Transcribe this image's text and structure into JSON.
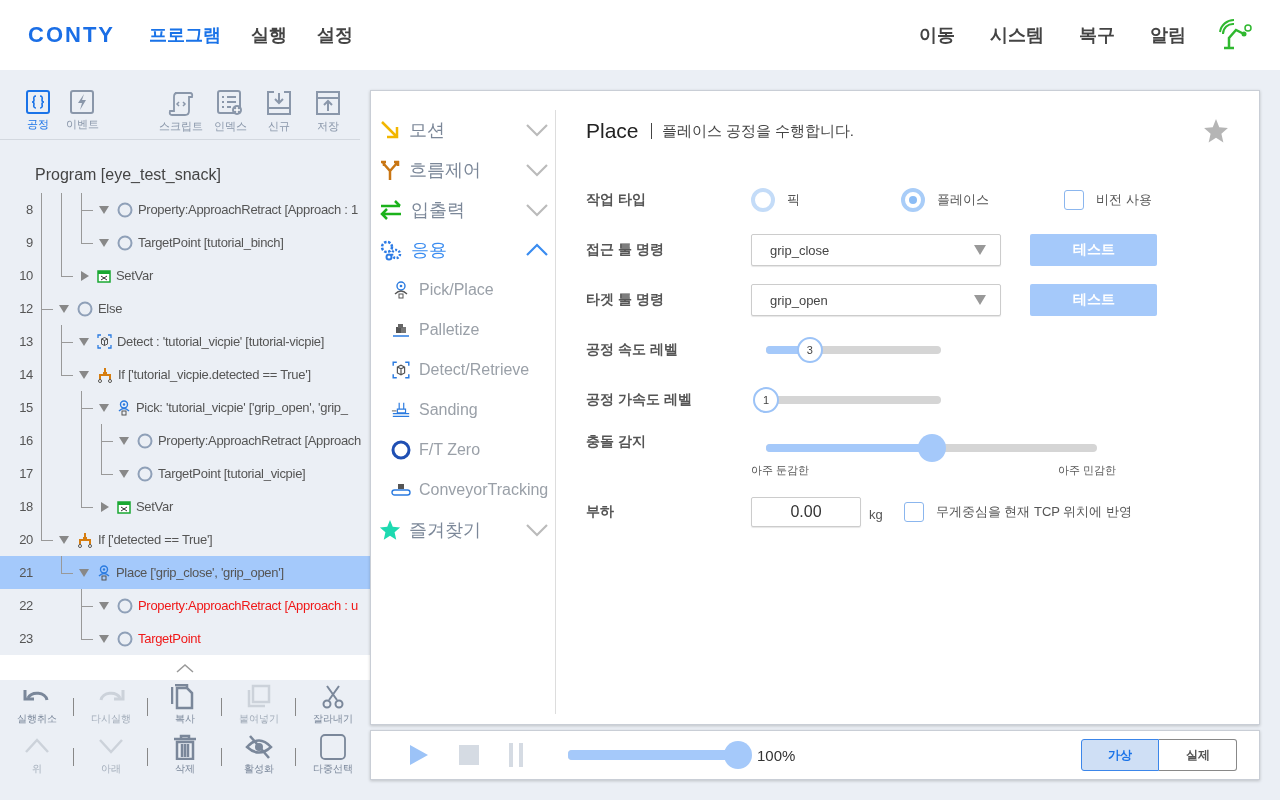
{
  "header": {
    "logo": "CONTY",
    "nav": [
      {
        "label": "프로그램",
        "selected": true
      },
      {
        "label": "실행",
        "selected": false
      },
      {
        "label": "설정",
        "selected": false
      }
    ],
    "menu": [
      "이동",
      "시스템",
      "복구",
      "알림"
    ]
  },
  "left_panel": {
    "tabs": [
      {
        "label": "공정",
        "kind": "process",
        "selected": true
      },
      {
        "label": "이벤트",
        "kind": "event",
        "selected": false
      }
    ],
    "actions": [
      {
        "label": "스크립트",
        "kind": "script"
      },
      {
        "label": "인덱스",
        "kind": "index"
      },
      {
        "label": "신규",
        "kind": "new"
      },
      {
        "label": "저장",
        "kind": "save"
      }
    ],
    "program_title": "Program [eye_test_snack]",
    "tree": [
      {
        "children": [
          {
            "children": [
              {
                "line": "8",
                "label": "Property:ApproachRetract [Approach : 1",
                "kind": "property",
                "expanded": true,
                "error": false,
                "selected": false
              },
              {
                "line": "9",
                "label": "TargetPoint [tutorial_binch]",
                "kind": "property",
                "expanded": true,
                "error": false,
                "selected": false
              }
            ]
          },
          {
            "line": "10",
            "label": "SetVar",
            "kind": "setvar",
            "expanded": false,
            "error": false,
            "selected": false
          }
        ]
      },
      {
        "line": "12",
        "label": "Else",
        "kind": "property",
        "expanded": true,
        "error": false,
        "selected": false,
        "children": [
          {
            "line": "13",
            "label": "Detect : 'tutorial_vicpie' [tutorial-vicpie]",
            "kind": "detect",
            "expanded": true,
            "error": false,
            "selected": false
          },
          {
            "line": "14",
            "label": "If ['tutorial_vicpie.detected == True']",
            "kind": "if",
            "expanded": true,
            "error": false,
            "selected": false,
            "children": [
              {
                "line": "15",
                "label": "Pick: 'tutorial_vicpie' ['grip_open', 'grip_",
                "kind": "pick",
                "expanded": true,
                "error": false,
                "selected": false,
                "children": [
                  {
                    "line": "16",
                    "label": "Property:ApproachRetract [Approach",
                    "kind": "property",
                    "expanded": true,
                    "error": false,
                    "selected": false
                  },
                  {
                    "line": "17",
                    "label": "TargetPoint [tutorial_vicpie]",
                    "kind": "property",
                    "expanded": true,
                    "error": false,
                    "selected": false
                  }
                ]
              },
              {
                "line": "18",
                "label": "SetVar",
                "kind": "setvar",
                "expanded": false,
                "error": false,
                "selected": false
              }
            ]
          }
        ]
      },
      {
        "line": "20",
        "label": "If ['detected == True']",
        "kind": "if",
        "expanded": true,
        "error": false,
        "selected": false,
        "children": [
          {
            "line": "21",
            "label": "Place ['grip_close', 'grip_open']",
            "kind": "place",
            "expanded": true,
            "error": false,
            "selected": true,
            "children": [
              {
                "line": "22",
                "label": "Property:ApproachRetract [Approach : u",
                "kind": "property",
                "expanded": true,
                "error": true,
                "selected": false
              },
              {
                "line": "23",
                "label": "TargetPoint",
                "kind": "property",
                "expanded": true,
                "error": true,
                "selected": false
              }
            ]
          }
        ]
      }
    ],
    "edit_tools": [
      {
        "label": "실행취소",
        "kind": "undo",
        "disabled": false
      },
      {
        "label": "다시실행",
        "kind": "redo",
        "disabled": true
      },
      {
        "label": "복사",
        "kind": "copy",
        "disabled": false
      },
      {
        "label": "붙여넣기",
        "kind": "paste",
        "disabled": true
      },
      {
        "label": "잘라내기",
        "kind": "cut",
        "disabled": false
      },
      {
        "label": "위",
        "kind": "up",
        "disabled": true
      },
      {
        "label": "아래",
        "kind": "down",
        "disabled": true
      },
      {
        "label": "삭제",
        "kind": "delete",
        "disabled": false
      },
      {
        "label": "활성화",
        "kind": "hide",
        "disabled": false
      },
      {
        "label": "다중선택",
        "kind": "multi",
        "disabled": false
      }
    ]
  },
  "palette": {
    "categories": [
      {
        "label": "모션",
        "kind": "motion",
        "expanded": false
      },
      {
        "label": "흐름제어",
        "kind": "flow",
        "expanded": false
      },
      {
        "label": "입출력",
        "kind": "io",
        "expanded": false
      },
      {
        "label": "응용",
        "kind": "app",
        "expanded": true,
        "items": [
          {
            "label": "Pick/Place",
            "kind": "pick"
          },
          {
            "label": "Palletize",
            "kind": "pallet"
          },
          {
            "label": "Detect/Retrieve",
            "kind": "detect"
          },
          {
            "label": "Sanding",
            "kind": "sanding"
          },
          {
            "label": "F/T Zero",
            "kind": "ftzero"
          },
          {
            "label": "ConveyorTracking",
            "kind": "conveyor"
          }
        ]
      },
      {
        "label": "즐겨찾기",
        "kind": "favorites",
        "expanded": false
      }
    ]
  },
  "form": {
    "title": "Place",
    "description": "플레이스 공정을 수행합니다.",
    "favorite": false,
    "rows": [
      {
        "kind": "choice",
        "label": "작업 타입",
        "radios": [
          {
            "label": "픽",
            "selected": false
          },
          {
            "label": "플레이스",
            "selected": true
          }
        ],
        "checkbox": {
          "label": "비전 사용",
          "checked": false
        }
      },
      {
        "kind": "select",
        "label": "접근 툴 명령",
        "value": "grip_close",
        "button": "테스트"
      },
      {
        "kind": "select",
        "label": "타겟 툴 명령",
        "value": "grip_open",
        "button": "테스트"
      },
      {
        "kind": "slider",
        "label": "공정 속도 레벨",
        "reading": "3",
        "level": 0.25
      },
      {
        "kind": "slider",
        "label": "공정 가속도 레벨",
        "reading": "1",
        "level": 0
      },
      {
        "kind": "range",
        "label": "충돌 감지",
        "level": 0.5,
        "min_label": "아주 둔감한",
        "max_label": "아주 민감한"
      },
      {
        "kind": "number",
        "label": "부하",
        "value": "0.00",
        "unit": "kg",
        "checkbox": {
          "label": "무게중심을 현재 TCP 위치에 반영",
          "checked": false
        }
      }
    ]
  },
  "run_bar": {
    "speed": {
      "level": 1,
      "reading": "100%"
    },
    "modes": [
      {
        "label": "가상",
        "selected": true
      },
      {
        "label": "실제",
        "selected": false
      }
    ]
  }
}
